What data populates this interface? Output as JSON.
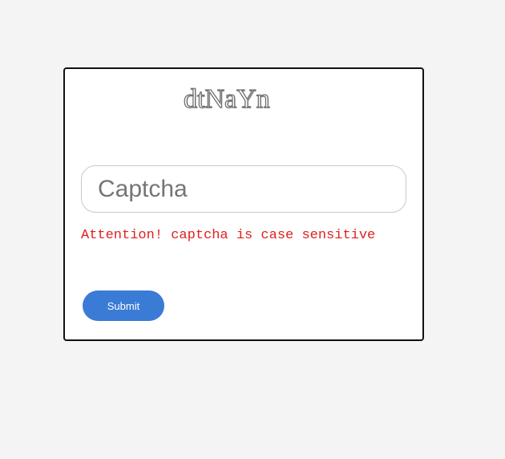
{
  "captcha": {
    "code": "dtNaYn"
  },
  "input": {
    "placeholder": "Captcha",
    "value": ""
  },
  "warning": {
    "text": "Attention! captcha is case sensitive",
    "color": "#e02020"
  },
  "submit": {
    "label": "Submit",
    "color": "#3a7bd5"
  }
}
